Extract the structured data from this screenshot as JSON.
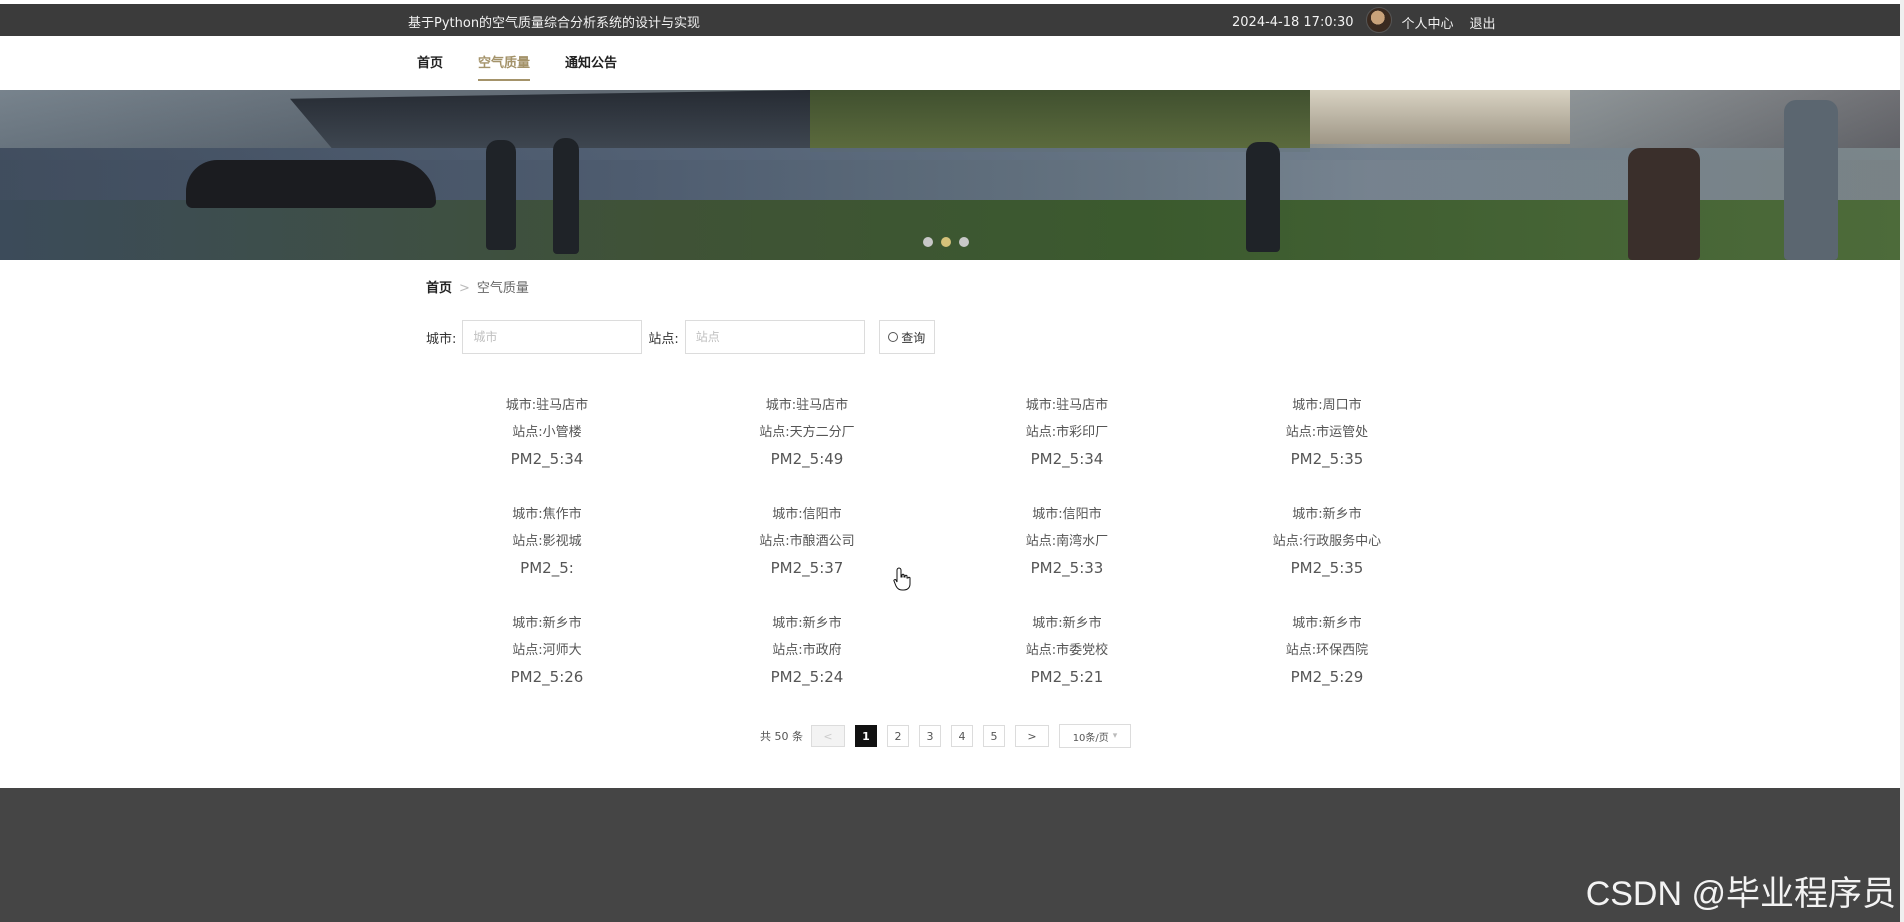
{
  "header": {
    "title": "基于Python的空气质量综合分析系统的设计与实现",
    "datetime": "2024-4-18 17:0:30",
    "profile_label": "个人中心",
    "logout_label": "退出"
  },
  "nav": {
    "items": [
      {
        "label": "首页",
        "active": false
      },
      {
        "label": "空气质量",
        "active": true
      },
      {
        "label": "通知公告",
        "active": false
      }
    ]
  },
  "banner": {
    "slides": 3,
    "active_slide": 2
  },
  "breadcrumb": {
    "home": "首页",
    "separator": ">",
    "current": "空气质量"
  },
  "search": {
    "city_label": "城市:",
    "city_placeholder": "城市",
    "station_label": "站点:",
    "station_placeholder": "站点",
    "button_label": "查询"
  },
  "records": [
    {
      "city": "城市:驻马店市",
      "station": "站点:小管楼",
      "pm": "PM2_5:34"
    },
    {
      "city": "城市:驻马店市",
      "station": "站点:天方二分厂",
      "pm": "PM2_5:49"
    },
    {
      "city": "城市:驻马店市",
      "station": "站点:市彩印厂",
      "pm": "PM2_5:34"
    },
    {
      "city": "城市:周口市",
      "station": "站点:市运管处",
      "pm": "PM2_5:35"
    },
    {
      "city": "城市:焦作市",
      "station": "站点:影视城",
      "pm": "PM2_5:"
    },
    {
      "city": "城市:信阳市",
      "station": "站点:市酿酒公司",
      "pm": "PM2_5:37"
    },
    {
      "city": "城市:信阳市",
      "station": "站点:南湾水厂",
      "pm": "PM2_5:33"
    },
    {
      "city": "城市:新乡市",
      "station": "站点:行政服务中心",
      "pm": "PM2_5:35"
    },
    {
      "city": "城市:新乡市",
      "station": "站点:河师大",
      "pm": "PM2_5:26"
    },
    {
      "city": "城市:新乡市",
      "station": "站点:市政府",
      "pm": "PM2_5:24"
    },
    {
      "city": "城市:新乡市",
      "station": "站点:市委党校",
      "pm": "PM2_5:21"
    },
    {
      "city": "城市:新乡市",
      "station": "站点:环保西院",
      "pm": "PM2_5:29"
    }
  ],
  "pagination": {
    "total_text": "共 50 条",
    "prev": "<",
    "next": ">",
    "pages": [
      "1",
      "2",
      "3",
      "4",
      "5"
    ],
    "current_page": "1",
    "page_size": "10条/页"
  },
  "watermark": "CSDN @毕业程序员",
  "colors": {
    "topbar": "#3b3b3b",
    "accent": "#a4936a",
    "footer": "#454545"
  }
}
